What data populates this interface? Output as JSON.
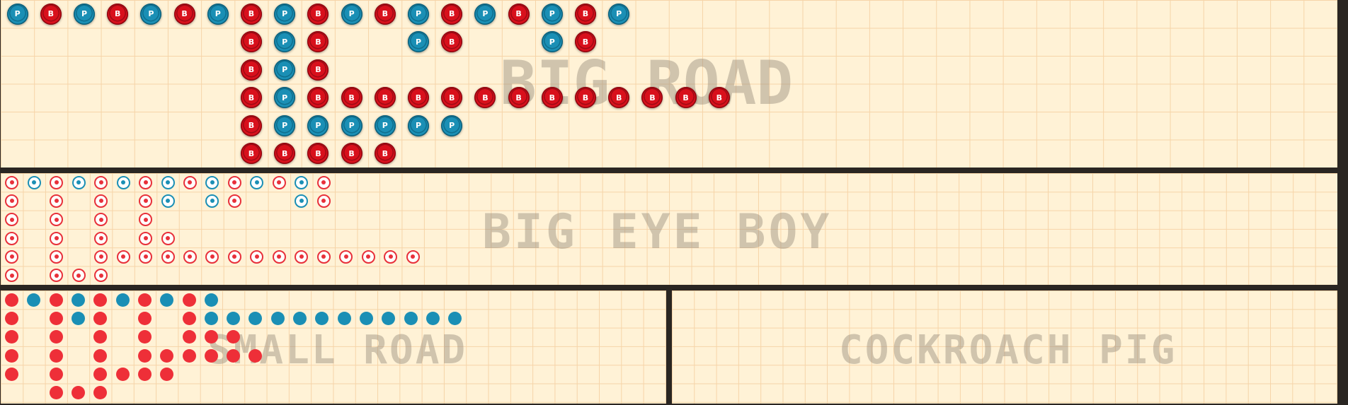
{
  "labels": {
    "big_road": "BIG ROAD",
    "big_eye_boy": "BIG EYE BOY",
    "small_road": "SMALL ROAD",
    "cockroach_pig": "COCKROACH PIG"
  },
  "marker_text": {
    "player": "P",
    "banker": "B"
  },
  "colors": {
    "grid_background": "#fff2d6",
    "grid_line": "#f6d4a8",
    "divider": "#2a2622",
    "player": "#1a8fb5",
    "banker": "#d8101c",
    "watermark": "#968c7d"
  },
  "big_road": {
    "columns": 40,
    "rows": 6,
    "marks": [
      {
        "col": 0,
        "row": 0,
        "v": "P"
      },
      {
        "col": 1,
        "row": 0,
        "v": "B"
      },
      {
        "col": 2,
        "row": 0,
        "v": "P"
      },
      {
        "col": 3,
        "row": 0,
        "v": "B"
      },
      {
        "col": 4,
        "row": 0,
        "v": "P"
      },
      {
        "col": 5,
        "row": 0,
        "v": "B"
      },
      {
        "col": 6,
        "row": 0,
        "v": "P"
      },
      {
        "col": 7,
        "row": 0,
        "v": "B"
      },
      {
        "col": 7,
        "row": 1,
        "v": "B"
      },
      {
        "col": 7,
        "row": 2,
        "v": "B"
      },
      {
        "col": 7,
        "row": 3,
        "v": "B"
      },
      {
        "col": 7,
        "row": 4,
        "v": "B"
      },
      {
        "col": 7,
        "row": 5,
        "v": "B"
      },
      {
        "col": 8,
        "row": 0,
        "v": "P"
      },
      {
        "col": 8,
        "row": 1,
        "v": "P"
      },
      {
        "col": 8,
        "row": 2,
        "v": "P"
      },
      {
        "col": 8,
        "row": 3,
        "v": "P"
      },
      {
        "col": 8,
        "row": 4,
        "v": "P"
      },
      {
        "col": 8,
        "row": 5,
        "v": "B"
      },
      {
        "col": 9,
        "row": 0,
        "v": "B"
      },
      {
        "col": 9,
        "row": 1,
        "v": "B"
      },
      {
        "col": 9,
        "row": 2,
        "v": "B"
      },
      {
        "col": 9,
        "row": 3,
        "v": "B"
      },
      {
        "col": 9,
        "row": 5,
        "v": "B"
      },
      {
        "col": 9,
        "row": 4,
        "v": "P"
      },
      {
        "col": 10,
        "row": 0,
        "v": "P"
      },
      {
        "col": 10,
        "row": 4,
        "v": "P"
      },
      {
        "col": 10,
        "row": 3,
        "v": "B"
      },
      {
        "col": 10,
        "row": 5,
        "v": "B"
      },
      {
        "col": 11,
        "row": 0,
        "v": "B"
      },
      {
        "col": 11,
        "row": 3,
        "v": "B"
      },
      {
        "col": 11,
        "row": 5,
        "v": "B"
      },
      {
        "col": 11,
        "row": 4,
        "v": "P"
      },
      {
        "col": 12,
        "row": 0,
        "v": "P"
      },
      {
        "col": 12,
        "row": 1,
        "v": "P"
      },
      {
        "col": 12,
        "row": 4,
        "v": "P"
      },
      {
        "col": 12,
        "row": 3,
        "v": "B"
      },
      {
        "col": 13,
        "row": 0,
        "v": "B"
      },
      {
        "col": 13,
        "row": 1,
        "v": "B"
      },
      {
        "col": 13,
        "row": 3,
        "v": "B"
      },
      {
        "col": 13,
        "row": 4,
        "v": "P"
      },
      {
        "col": 14,
        "row": 0,
        "v": "P"
      },
      {
        "col": 14,
        "row": 3,
        "v": "B"
      },
      {
        "col": 15,
        "row": 0,
        "v": "B"
      },
      {
        "col": 15,
        "row": 3,
        "v": "B"
      },
      {
        "col": 16,
        "row": 0,
        "v": "P"
      },
      {
        "col": 16,
        "row": 1,
        "v": "P"
      },
      {
        "col": 16,
        "row": 3,
        "v": "B"
      },
      {
        "col": 17,
        "row": 0,
        "v": "B"
      },
      {
        "col": 17,
        "row": 1,
        "v": "B"
      },
      {
        "col": 17,
        "row": 3,
        "v": "B"
      },
      {
        "col": 18,
        "row": 0,
        "v": "P"
      },
      {
        "col": 18,
        "row": 3,
        "v": "B"
      },
      {
        "col": 19,
        "row": 3,
        "v": "B"
      },
      {
        "col": 20,
        "row": 3,
        "v": "B"
      },
      {
        "col": 21,
        "row": 3,
        "v": "B"
      }
    ]
  },
  "big_eye_boy": {
    "columns": 60,
    "rows": 6,
    "marks": [
      {
        "col": 0,
        "row": 0,
        "v": "B"
      },
      {
        "col": 0,
        "row": 1,
        "v": "B"
      },
      {
        "col": 0,
        "row": 2,
        "v": "B"
      },
      {
        "col": 0,
        "row": 3,
        "v": "B"
      },
      {
        "col": 0,
        "row": 4,
        "v": "B"
      },
      {
        "col": 0,
        "row": 5,
        "v": "B"
      },
      {
        "col": 1,
        "row": 0,
        "v": "P"
      },
      {
        "col": 2,
        "row": 0,
        "v": "B"
      },
      {
        "col": 2,
        "row": 1,
        "v": "B"
      },
      {
        "col": 2,
        "row": 2,
        "v": "B"
      },
      {
        "col": 2,
        "row": 3,
        "v": "B"
      },
      {
        "col": 2,
        "row": 4,
        "v": "B"
      },
      {
        "col": 2,
        "row": 5,
        "v": "B"
      },
      {
        "col": 3,
        "row": 0,
        "v": "P"
      },
      {
        "col": 3,
        "row": 5,
        "v": "B"
      },
      {
        "col": 4,
        "row": 0,
        "v": "B"
      },
      {
        "col": 4,
        "row": 1,
        "v": "B"
      },
      {
        "col": 4,
        "row": 2,
        "v": "B"
      },
      {
        "col": 4,
        "row": 3,
        "v": "B"
      },
      {
        "col": 4,
        "row": 4,
        "v": "B"
      },
      {
        "col": 4,
        "row": 5,
        "v": "B"
      },
      {
        "col": 5,
        "row": 0,
        "v": "P"
      },
      {
        "col": 5,
        "row": 4,
        "v": "B"
      },
      {
        "col": 6,
        "row": 0,
        "v": "B"
      },
      {
        "col": 6,
        "row": 1,
        "v": "B"
      },
      {
        "col": 6,
        "row": 2,
        "v": "B"
      },
      {
        "col": 6,
        "row": 3,
        "v": "B"
      },
      {
        "col": 6,
        "row": 4,
        "v": "B"
      },
      {
        "col": 7,
        "row": 0,
        "v": "P"
      },
      {
        "col": 7,
        "row": 1,
        "v": "P"
      },
      {
        "col": 7,
        "row": 3,
        "v": "B"
      },
      {
        "col": 7,
        "row": 4,
        "v": "B"
      },
      {
        "col": 8,
        "row": 0,
        "v": "B"
      },
      {
        "col": 8,
        "row": 4,
        "v": "B"
      },
      {
        "col": 9,
        "row": 0,
        "v": "P"
      },
      {
        "col": 9,
        "row": 1,
        "v": "P"
      },
      {
        "col": 9,
        "row": 4,
        "v": "B"
      },
      {
        "col": 10,
        "row": 0,
        "v": "B"
      },
      {
        "col": 10,
        "row": 1,
        "v": "B"
      },
      {
        "col": 10,
        "row": 4,
        "v": "B"
      },
      {
        "col": 11,
        "row": 0,
        "v": "P"
      },
      {
        "col": 11,
        "row": 4,
        "v": "B"
      },
      {
        "col": 12,
        "row": 0,
        "v": "B"
      },
      {
        "col": 12,
        "row": 4,
        "v": "B"
      },
      {
        "col": 13,
        "row": 0,
        "v": "P"
      },
      {
        "col": 13,
        "row": 1,
        "v": "P"
      },
      {
        "col": 13,
        "row": 4,
        "v": "B"
      },
      {
        "col": 14,
        "row": 0,
        "v": "B"
      },
      {
        "col": 14,
        "row": 1,
        "v": "B"
      },
      {
        "col": 14,
        "row": 4,
        "v": "B"
      },
      {
        "col": 15,
        "row": 4,
        "v": "B"
      },
      {
        "col": 16,
        "row": 4,
        "v": "B"
      },
      {
        "col": 17,
        "row": 4,
        "v": "B"
      },
      {
        "col": 18,
        "row": 4,
        "v": "B"
      }
    ]
  },
  "small_road": {
    "columns": 30,
    "rows": 6,
    "marks": [
      {
        "col": 0,
        "row": 0,
        "v": "B"
      },
      {
        "col": 0,
        "row": 1,
        "v": "B"
      },
      {
        "col": 0,
        "row": 2,
        "v": "B"
      },
      {
        "col": 0,
        "row": 3,
        "v": "B"
      },
      {
        "col": 0,
        "row": 4,
        "v": "B"
      },
      {
        "col": 1,
        "row": 0,
        "v": "P"
      },
      {
        "col": 2,
        "row": 0,
        "v": "B"
      },
      {
        "col": 2,
        "row": 1,
        "v": "B"
      },
      {
        "col": 2,
        "row": 2,
        "v": "B"
      },
      {
        "col": 2,
        "row": 3,
        "v": "B"
      },
      {
        "col": 2,
        "row": 4,
        "v": "B"
      },
      {
        "col": 2,
        "row": 5,
        "v": "B"
      },
      {
        "col": 3,
        "row": 0,
        "v": "P"
      },
      {
        "col": 3,
        "row": 1,
        "v": "P"
      },
      {
        "col": 3,
        "row": 5,
        "v": "B"
      },
      {
        "col": 4,
        "row": 0,
        "v": "B"
      },
      {
        "col": 4,
        "row": 1,
        "v": "B"
      },
      {
        "col": 4,
        "row": 2,
        "v": "B"
      },
      {
        "col": 4,
        "row": 3,
        "v": "B"
      },
      {
        "col": 4,
        "row": 4,
        "v": "B"
      },
      {
        "col": 4,
        "row": 5,
        "v": "B"
      },
      {
        "col": 5,
        "row": 0,
        "v": "P"
      },
      {
        "col": 5,
        "row": 4,
        "v": "B"
      },
      {
        "col": 6,
        "row": 0,
        "v": "B"
      },
      {
        "col": 6,
        "row": 1,
        "v": "B"
      },
      {
        "col": 6,
        "row": 2,
        "v": "B"
      },
      {
        "col": 6,
        "row": 3,
        "v": "B"
      },
      {
        "col": 6,
        "row": 4,
        "v": "B"
      },
      {
        "col": 7,
        "row": 0,
        "v": "P"
      },
      {
        "col": 7,
        "row": 3,
        "v": "B"
      },
      {
        "col": 7,
        "row": 4,
        "v": "B"
      },
      {
        "col": 8,
        "row": 0,
        "v": "B"
      },
      {
        "col": 8,
        "row": 1,
        "v": "B"
      },
      {
        "col": 8,
        "row": 2,
        "v": "B"
      },
      {
        "col": 8,
        "row": 3,
        "v": "B"
      },
      {
        "col": 9,
        "row": 0,
        "v": "P"
      },
      {
        "col": 9,
        "row": 1,
        "v": "P"
      },
      {
        "col": 9,
        "row": 2,
        "v": "B"
      },
      {
        "col": 9,
        "row": 3,
        "v": "B"
      },
      {
        "col": 10,
        "row": 1,
        "v": "P"
      },
      {
        "col": 10,
        "row": 2,
        "v": "B"
      },
      {
        "col": 10,
        "row": 3,
        "v": "B"
      },
      {
        "col": 11,
        "row": 1,
        "v": "P"
      },
      {
        "col": 11,
        "row": 3,
        "v": "B"
      },
      {
        "col": 12,
        "row": 1,
        "v": "P"
      },
      {
        "col": 13,
        "row": 1,
        "v": "P"
      },
      {
        "col": 14,
        "row": 1,
        "v": "P"
      },
      {
        "col": 15,
        "row": 1,
        "v": "P"
      },
      {
        "col": 16,
        "row": 1,
        "v": "P"
      },
      {
        "col": 17,
        "row": 1,
        "v": "P"
      },
      {
        "col": 18,
        "row": 1,
        "v": "P"
      },
      {
        "col": 19,
        "row": 1,
        "v": "P"
      },
      {
        "col": 20,
        "row": 1,
        "v": "P"
      }
    ]
  },
  "cockroach_pig": {
    "columns": 30,
    "rows": 6,
    "marks": []
  }
}
